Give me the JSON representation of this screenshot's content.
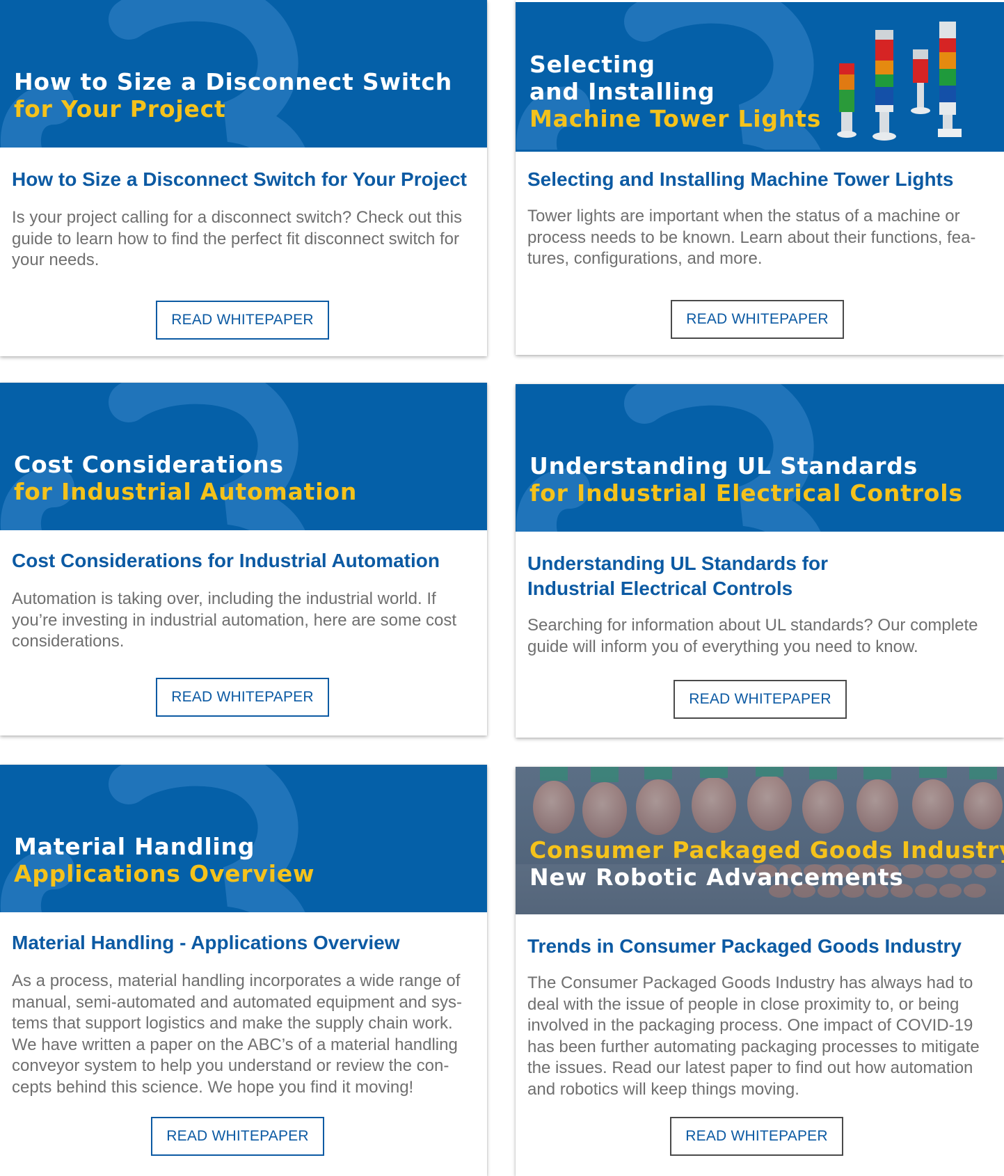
{
  "colors": {
    "banner_blue": "#0560a8",
    "banner_deco": "#2a7bc0",
    "title_blue": "#0c5aa3",
    "accent_yellow": "#f5c21b",
    "desc_gray": "#6f6f6f"
  },
  "cards": [
    {
      "banner_line1": "How to Size a Disconnect Switch",
      "banner_line2": "for Your Project",
      "title": "How to Size a Disconnect Switch for Your Project",
      "description": "Is your project calling for a disconnect switch? Check out this guide to learn how to find the perfect fit disconnect switch for your needs.",
      "button": "READ WHITEPAPER"
    },
    {
      "banner_line1": "Selecting",
      "banner_line2": "and Installing",
      "banner_line3": "Machine Tower Lights",
      "title": "Selecting and Installing Machine Tower Lights",
      "description": "Tower lights are important when the status of a machine or process needs to be known. Learn about their functions, fea-tures, configurations, and more.",
      "button": "READ WHITEPAPER"
    },
    {
      "banner_line1": "Cost Considerations",
      "banner_line2": "for Industrial Automation",
      "title": "Cost Considerations for Industrial Automation",
      "description": "Automation is taking over, including the industrial world. If you’re investing in industrial automation, here are some cost considerations.",
      "button": "READ WHITEPAPER"
    },
    {
      "banner_line1": "Understanding UL Standards",
      "banner_line2": "for Industrial Electrical Controls",
      "title": "Understanding UL Standards for Industrial Electrical Controls",
      "description": "Searching for information about UL standards? Our complete guide will inform you of everything you need to know.",
      "button": "READ WHITEPAPER"
    },
    {
      "banner_line1": "Material Handling",
      "banner_line2": "Applications Overview",
      "title": "Material Handling - Applications Overview",
      "description": "As a process, material handling incorporates a wide range of manual, semi-automated and automated equipment and sys-tems that support logistics and make the supply chain work. We have written a paper on the ABC’s of a material handling conveyor system to help you understand or review the con-cepts behind this science. We hope you find it moving!",
      "button": "READ WHITEPAPER"
    },
    {
      "banner_line1": "Consumer Packaged Goods Industry",
      "banner_line2": "New Robotic Advancements",
      "title": "Trends in Consumer Packaged Goods Industry",
      "description": "The Consumer Packaged Goods Industry has always had to deal with the issue of people in close proximity to, or being involved in the packaging process. One impact of COVID-19 has been further automating packaging processes to mitigate the issues. Read our latest paper to find out how automation and robotics will keep things moving.",
      "button": "READ WHITEPAPER"
    }
  ]
}
